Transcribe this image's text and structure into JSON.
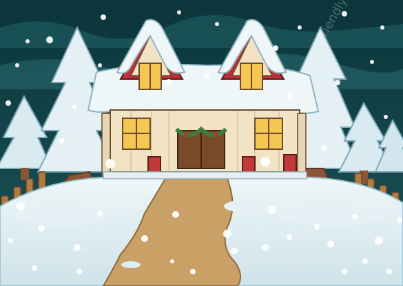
{
  "watermark": {
    "text": "friendlystock"
  },
  "colors": {
    "sky_dark": "#0d3b40",
    "sky_mid": "#1d5a5e",
    "snow": "#e9f3f6",
    "snow_shadow": "#bcd5de",
    "path": "#c9a066",
    "house_wall": "#f1e3c4",
    "roof_red": "#b8323a",
    "window_glow": "#f4c752",
    "door_brown": "#7a4a2b",
    "tree_trunk": "#8b5637",
    "fence": "#b07a44",
    "garland": "#3f7d3a"
  }
}
